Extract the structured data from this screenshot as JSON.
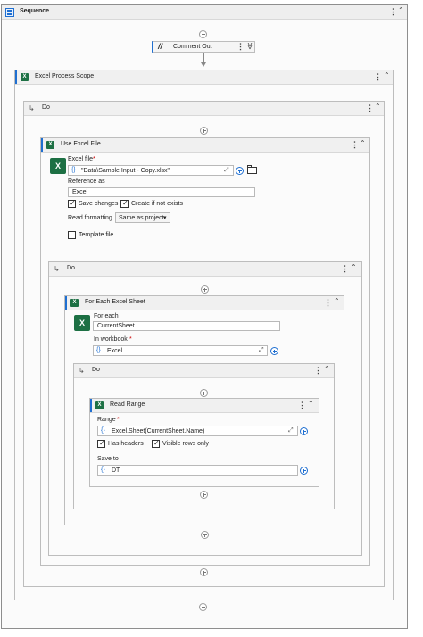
{
  "sequence": {
    "title": "Sequence"
  },
  "comment_out": {
    "label": "Comment Out"
  },
  "excel_scope": {
    "title": "Excel Process Scope"
  },
  "do_outer": {
    "label": "Do"
  },
  "use_excel": {
    "title": "Use Excel File",
    "excel_file_label": "Excel file",
    "required_mark": "*",
    "excel_file_value": "\"Data\\Sample Input - Copy.xlsx\"",
    "reference_label": "Reference as",
    "reference_value": "Excel",
    "save_changes": "Save changes",
    "create_if_not_exists": "Create if not exists",
    "read_formatting_label": "Read formatting",
    "read_formatting_value": "Same as project",
    "template_file": "Template file"
  },
  "do_mid": {
    "label": "Do"
  },
  "for_each": {
    "title": "For Each Excel Sheet",
    "for_each_label": "For each",
    "for_each_value": "CurrentSheet",
    "in_workbook_label": "In workbook",
    "required_mark": "*",
    "in_workbook_value": "Excel"
  },
  "do_inner": {
    "label": "Do"
  },
  "read_range": {
    "title": "Read Range",
    "range_label": "Range",
    "required_mark": "*",
    "range_value": "Excel.Sheet(CurrentSheet.Name)",
    "has_headers": "Has headers",
    "visible_rows_only": "Visible rows only",
    "save_to_label": "Save to",
    "save_to_value": "DT"
  },
  "glyphs": {
    "curly": "{}",
    "kebab": "⋮",
    "collapse": "⌃",
    "double_collapse": "≫",
    "do_arrow": "↳",
    "expand": "⤢",
    "dropdown": "▾"
  },
  "colors": {
    "excel_green": "#1d7044",
    "accent_blue": "#1f6fd1"
  }
}
